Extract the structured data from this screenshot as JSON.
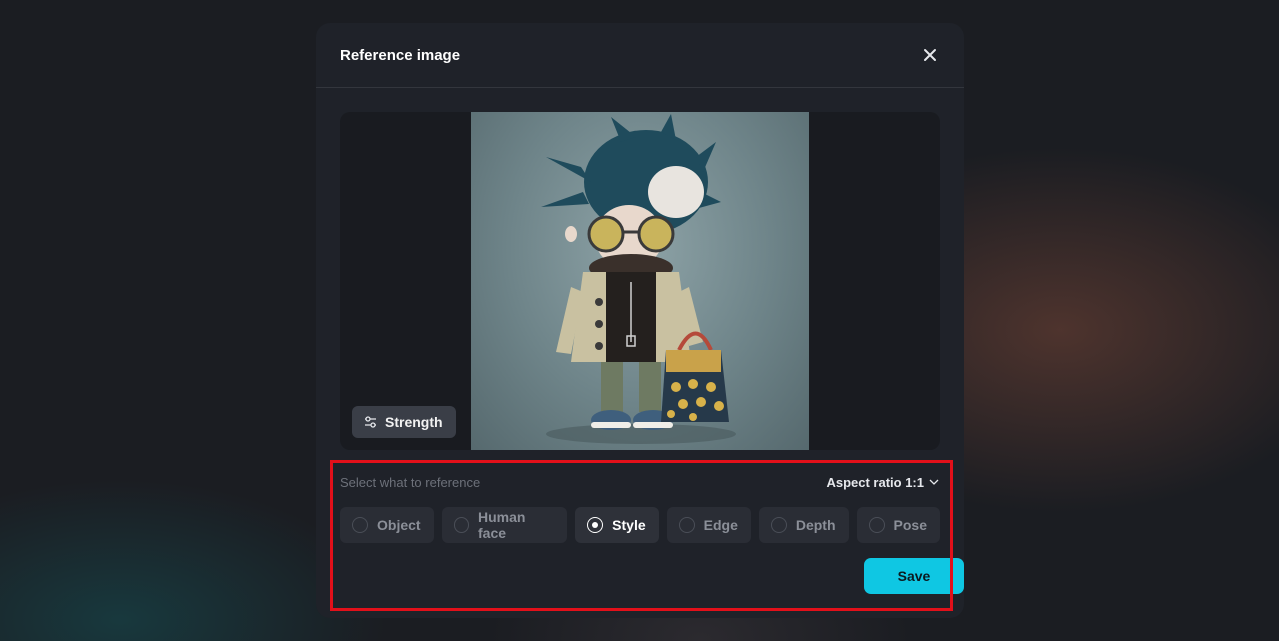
{
  "modal": {
    "title": "Reference image",
    "close_icon": "close-icon"
  },
  "preview": {
    "image_alt": "stylized character with blue spiky hair, round yellow sunglasses, beige jacket and yellow polka-dot bag",
    "strength_label": "Strength",
    "strength_icon": "sliders-icon"
  },
  "reference": {
    "prompt": "Select what to reference",
    "aspect_label": "Aspect ratio 1:1",
    "selected": "Style",
    "options": [
      {
        "label": "Object",
        "selected": false
      },
      {
        "label": "Human face",
        "selected": false
      },
      {
        "label": "Style",
        "selected": true
      },
      {
        "label": "Edge",
        "selected": false
      },
      {
        "label": "Depth",
        "selected": false
      },
      {
        "label": "Pose",
        "selected": false
      }
    ]
  },
  "actions": {
    "save_label": "Save"
  },
  "colors": {
    "accent": "#0fc7e3",
    "highlight": "#e2101a"
  }
}
